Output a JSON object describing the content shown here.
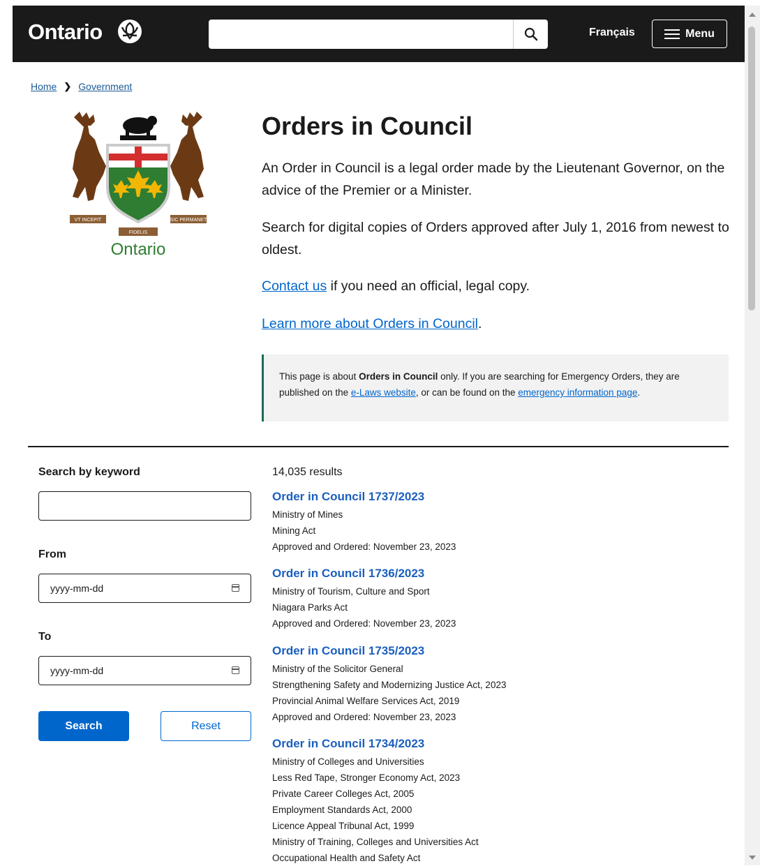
{
  "header": {
    "logo": "Ontario",
    "search_placeholder": "",
    "language": "Français",
    "menu": "Menu"
  },
  "breadcrumb": {
    "home": "Home",
    "government": "Government"
  },
  "emblem": {
    "motto_left": "VT INCEPIT",
    "motto_center": "FIDELIS",
    "motto_right": "SIC PERMANET",
    "label": "Ontario"
  },
  "page": {
    "title": "Orders in Council",
    "intro1": "An Order in Council is a legal order made by the Lieutenant Governor, on the advice of the Premier or a Minister.",
    "intro2": "Search for digital copies of Orders approved after July 1, 2016 from newest to oldest.",
    "contact_link": "Contact us",
    "contact_rest": " if you need an official, legal copy.",
    "learn_link": "Learn more about Orders in Council",
    "learn_rest": "."
  },
  "callout": {
    "t1": "This page is about ",
    "bold": "Orders in Council",
    "t2": " only. If you are searching for Emergency Orders, they are published on the ",
    "link1": "e-Laws website",
    "t3": ", or can be found on the ",
    "link2": "emergency information page",
    "t4": "."
  },
  "filters": {
    "keyword_label": "Search by keyword",
    "from_label": "From",
    "to_label": "To",
    "date_placeholder": "yyyy-mm-dd",
    "search_button": "Search",
    "reset_button": "Reset"
  },
  "results": {
    "count": "14,035 results",
    "items": [
      {
        "title": "Order in Council 1737/2023",
        "lines": [
          "Ministry of Mines",
          "Mining Act",
          "Approved and Ordered: November 23, 2023"
        ]
      },
      {
        "title": "Order in Council 1736/2023",
        "lines": [
          "Ministry of Tourism, Culture and Sport",
          "Niagara Parks Act",
          "Approved and Ordered: November 23, 2023"
        ]
      },
      {
        "title": "Order in Council 1735/2023",
        "lines": [
          "Ministry of the Solicitor General",
          "Strengthening Safety and Modernizing Justice Act, 2023",
          "Provincial Animal Welfare Services Act, 2019",
          "Approved and Ordered: November 23, 2023"
        ]
      },
      {
        "title": "Order in Council 1734/2023",
        "lines": [
          "Ministry of Colleges and Universities",
          "Less Red Tape, Stronger Economy Act, 2023",
          "Private Career Colleges Act, 2005",
          "Employment Standards Act, 2000",
          "Licence Appeal Tribunal Act, 1999",
          "Ministry of Training, Colleges and Universities Act",
          "Occupational Health and Safety Act"
        ]
      }
    ]
  }
}
